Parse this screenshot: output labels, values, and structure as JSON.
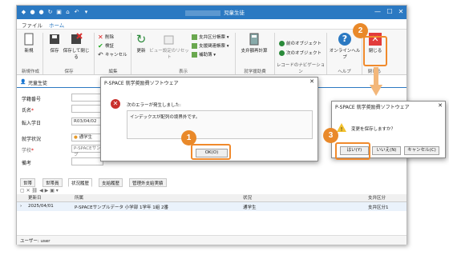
{
  "window": {
    "title": "児童生徒"
  },
  "ribbon": {
    "tabs": [
      "ファイル",
      "ホーム"
    ],
    "new_label": "新規",
    "save_label": "保存",
    "save_close_label": "保存して閉じる",
    "delete_label": "削除",
    "verify_label": "検証",
    "cancel_label": "キャンセル",
    "refresh_label": "更新",
    "view_reset_label": "ビュー設定のリセット",
    "support_type_label": "支弁区分帳票",
    "support_related_label": "支援関連帳票",
    "aux_label": "補助簿",
    "support_calc_label": "支弁額再計算",
    "prev_obj_label": "前のオブジェクト",
    "next_obj_label": "次のオブジェクト",
    "online_help_label": "オンラインヘルプ",
    "close_label": "閉じる",
    "groups": [
      "新規作成",
      "保存",
      "編集",
      "表示",
      "就学援助費",
      "レコードのナビゲーション",
      "ヘルプ",
      "閉じる"
    ]
  },
  "form": {
    "doc_tab": "児童生徒",
    "student_no": "学籍番号",
    "name": "氏名",
    "transfer_date": "転入学日",
    "transfer_date_value": "R03/04/02",
    "enrollment": "就学状況",
    "enrollment_value": "通学生",
    "school": "学校",
    "school_value": "P-SPACEサンプ",
    "remarks": "備考"
  },
  "bottom_tabs": [
    "世帯",
    "世帯員",
    "状況履歴",
    "支給履歴",
    "管理外支給実績"
  ],
  "grid": {
    "headers": [
      "更新日",
      "所属",
      "状況",
      "支弁区分"
    ],
    "row": {
      "date": "2025/04/01",
      "affiliation": "P-SPACEサンプルデータ 小学部 1学年 1組 2番",
      "status": "通学生",
      "category": "支弁区分1"
    }
  },
  "status_bar": "ユーザー: user",
  "error_dialog": {
    "title": "P-SPACE 就学奨励費ソフトウェア",
    "message": "次のエラーが発生しました:",
    "detail": "インデックスが配列の境界外です。",
    "ok": "OK(O)"
  },
  "confirm_dialog": {
    "title": "P-SPACE 就学奨励費ソフトウェア",
    "message": "変更を保存しますか？",
    "yes": "はい(Y)",
    "no": "いいえ(N)",
    "cancel": "キャンセル(C)"
  },
  "steps": [
    "1",
    "2",
    "3"
  ],
  "colors": {
    "accent": "#2b79c2",
    "highlight": "#f08a2c",
    "badge": "#e9892a",
    "error": "#c9302c"
  }
}
